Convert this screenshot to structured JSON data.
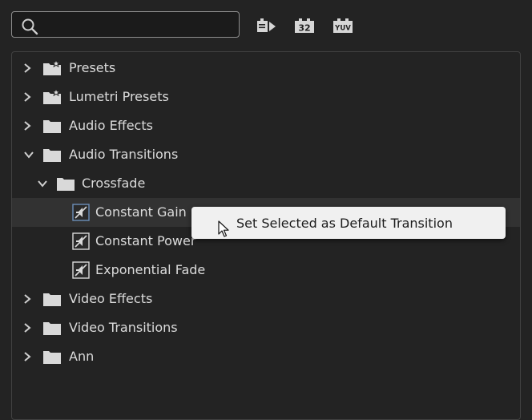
{
  "search": {
    "value": "",
    "placeholder": ""
  },
  "toolbar": {
    "accelerated_icon": "accelerated-effects-icon",
    "bit32_label": "32",
    "yuv_label": "YUV"
  },
  "tree": {
    "presets": "Presets",
    "lumetri_presets": "Lumetri Presets",
    "audio_effects": "Audio Effects",
    "audio_transitions": "Audio Transitions",
    "crossfade": "Crossfade",
    "constant_gain": "Constant Gain",
    "constant_power": "Constant Power",
    "exponential_fade": "Exponential Fade",
    "video_effects": "Video Effects",
    "video_transitions": "Video Transitions",
    "ann": "Ann"
  },
  "context_menu": {
    "set_default": "Set Selected as Default Transition"
  },
  "colors": {
    "background": "#232323",
    "selected_row": "#323232",
    "menu_background": "#f0f0f0",
    "text": "#dcdcdc"
  }
}
